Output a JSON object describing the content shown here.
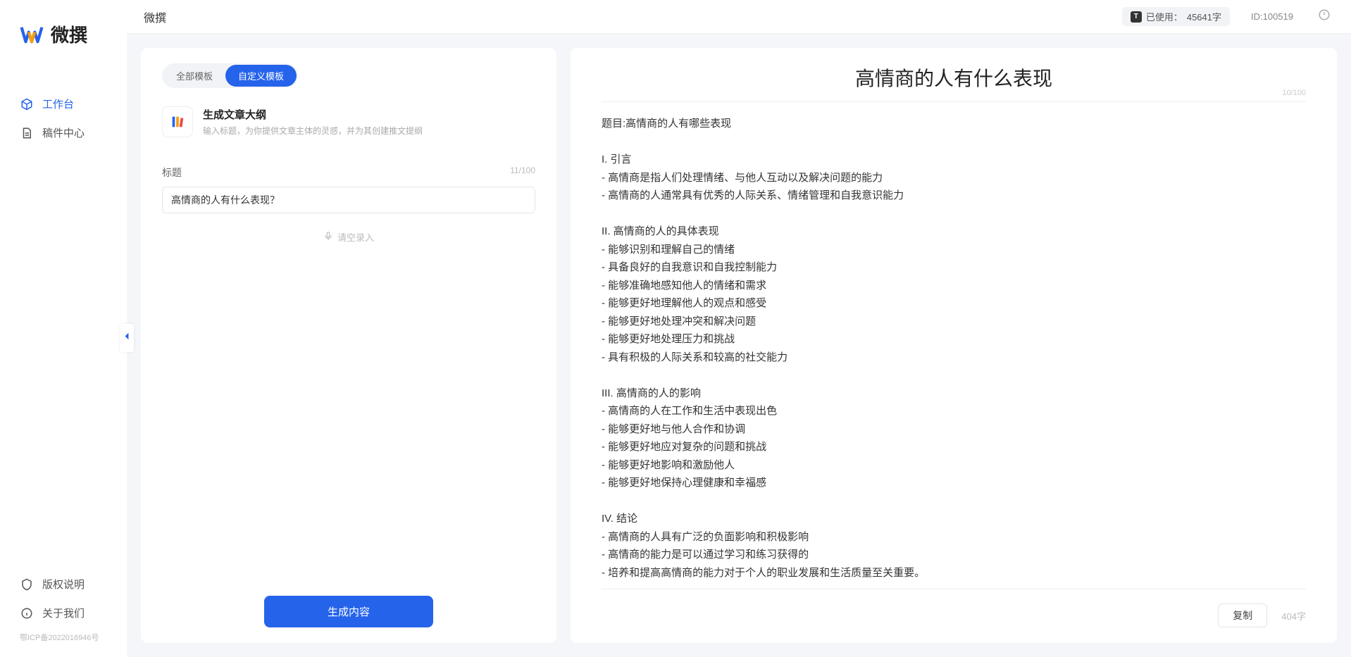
{
  "app_name": "微撰",
  "sidebar": {
    "logo_text": "微撰",
    "nav": [
      {
        "label": "工作台"
      },
      {
        "label": "稿件中心"
      }
    ],
    "footer": [
      {
        "label": "版权说明"
      },
      {
        "label": "关于我们"
      }
    ],
    "icp": "鄂ICP备2022016946号"
  },
  "topbar": {
    "title": "微撰",
    "usage_prefix": "已使用：",
    "usage_value": "45641字",
    "id_label": "ID:100519"
  },
  "left": {
    "tabs": [
      {
        "label": "全部模板"
      },
      {
        "label": "自定义模板"
      }
    ],
    "template": {
      "name": "生成文章大纲",
      "desc": "输入标题，为你提供文章主体的灵感，并为其创建推文提纲"
    },
    "field": {
      "label": "标题",
      "counter": "11/100",
      "value": "高情商的人有什么表现？"
    },
    "voice_hint": "请空录入",
    "generate_label": "生成内容"
  },
  "right": {
    "title": "高情商的人有什么表现",
    "title_counter": "10/100",
    "body": "题目:高情商的人有哪些表现\n\nI. 引言\n- 高情商是指人们处理情绪、与他人互动以及解决问题的能力\n- 高情商的人通常具有优秀的人际关系、情绪管理和自我意识能力\n\nII. 高情商的人的具体表现\n- 能够识别和理解自己的情绪\n- 具备良好的自我意识和自我控制能力\n- 能够准确地感知他人的情绪和需求\n- 能够更好地理解他人的观点和感受\n- 能够更好地处理冲突和解决问题\n- 能够更好地处理压力和挑战\n- 具有积极的人际关系和较高的社交能力\n\nIII. 高情商的人的影响\n- 高情商的人在工作和生活中表现出色\n- 能够更好地与他人合作和协调\n- 能够更好地应对复杂的问题和挑战\n- 能够更好地影响和激励他人\n- 能够更好地保持心理健康和幸福感\n\nIV. 结论\n- 高情商的人具有广泛的负面影响和积极影响\n- 高情商的能力是可以通过学习和练习获得的\n- 培养和提高高情商的能力对于个人的职业发展和生活质量至关重要。",
    "copy_label": "复制",
    "char_count": "404字"
  }
}
